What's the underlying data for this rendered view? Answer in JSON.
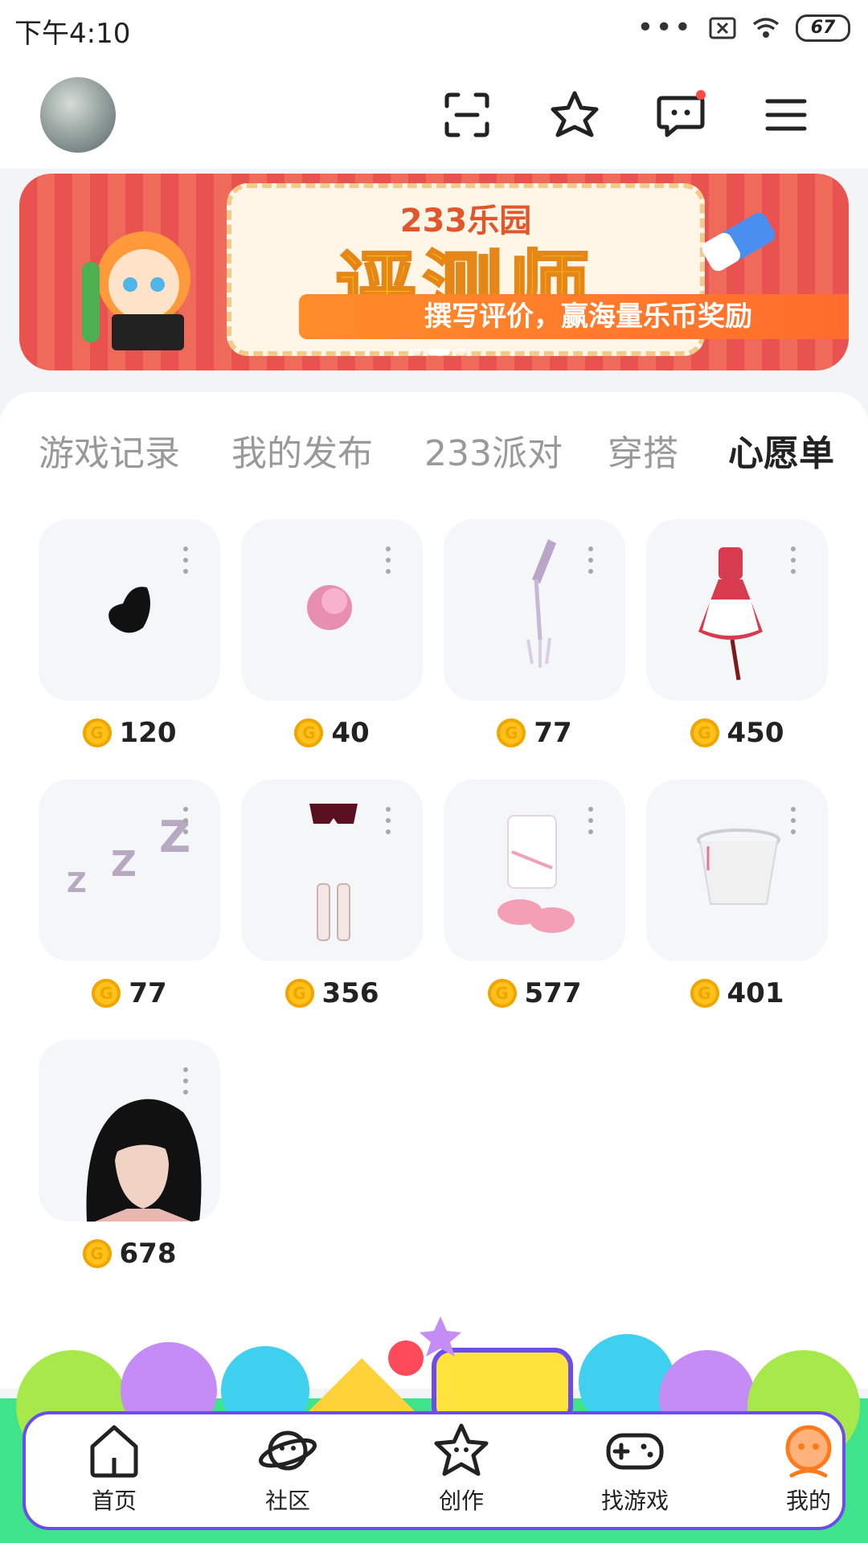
{
  "status": {
    "time": "下午4:10",
    "battery": "67"
  },
  "header": {
    "icons": [
      "scan-icon",
      "star-icon",
      "message-icon",
      "menu-icon"
    ]
  },
  "banner": {
    "brand": "233乐园",
    "title": "评测师",
    "subtitle": "撰写评价，赢海量乐币奖励"
  },
  "tabs": [
    {
      "label": "游戏记录"
    },
    {
      "label": "我的发布"
    },
    {
      "label": "233派对"
    },
    {
      "label": "穿搭"
    },
    {
      "label": "心愿单",
      "active": true
    }
  ],
  "wishlist": [
    {
      "item": "black-feather",
      "price": "120"
    },
    {
      "item": "pink-ball",
      "price": "40"
    },
    {
      "item": "crystal-staff",
      "price": "77"
    },
    {
      "item": "maid-dress",
      "price": "450"
    },
    {
      "item": "zzz-effect",
      "price": "77"
    },
    {
      "item": "shorts-socks",
      "price": "356"
    },
    {
      "item": "pink-outfit",
      "price": "577"
    },
    {
      "item": "white-veil",
      "price": "401"
    },
    {
      "item": "black-long-hair",
      "price": "678"
    }
  ],
  "nav": [
    {
      "label": "首页",
      "icon": "home-icon"
    },
    {
      "label": "社区",
      "icon": "planet-icon"
    },
    {
      "label": "创作",
      "icon": "create-star-icon"
    },
    {
      "label": "找游戏",
      "icon": "gamepad-icon"
    },
    {
      "label": "我的",
      "icon": "profile-face-icon",
      "active": true
    }
  ],
  "colors": {
    "accent": "#ff7a1a",
    "coin": "#ffc21a",
    "nav_border": "#6a4cf0"
  }
}
